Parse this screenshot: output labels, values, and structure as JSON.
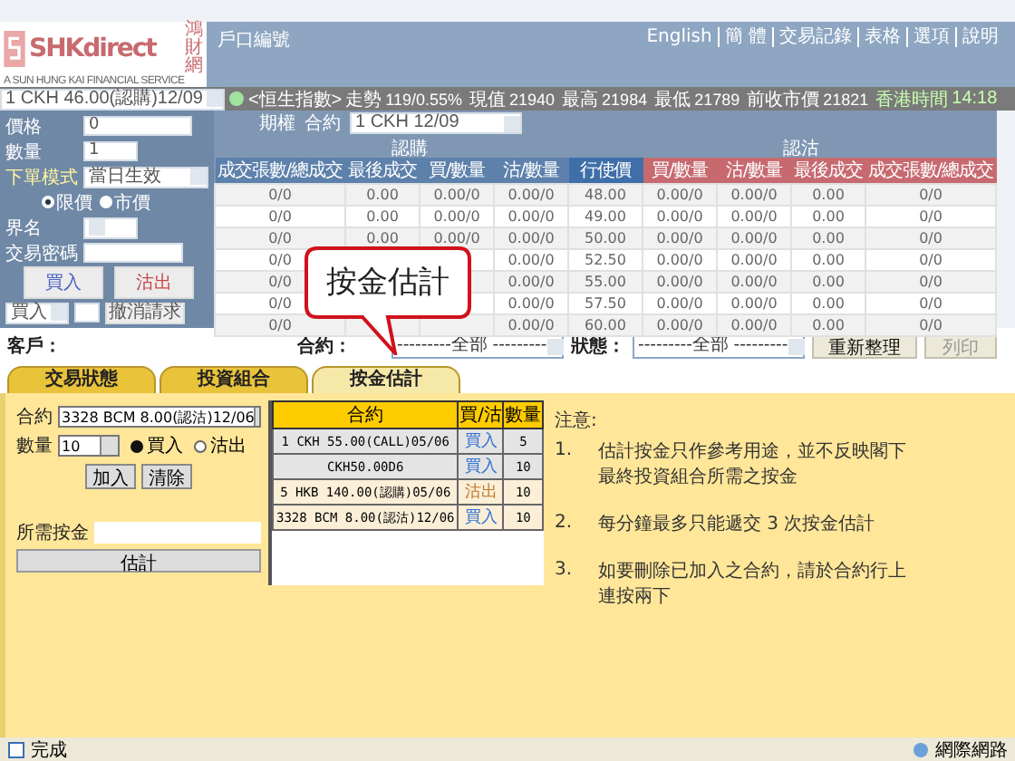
{
  "header": {
    "logo": "SHKdirect",
    "logo_tagline": "A SUN HUNG KAI FINANCIAL SERVICE",
    "logo_side": "鴻財網",
    "account_label": "戶口編號",
    "links": [
      "English",
      "簡 體",
      "交易記錄",
      "表格",
      "選項",
      "說明"
    ]
  },
  "ticker": {
    "contract": "1 CKH 46.00(認購)12/09",
    "index": "<恒生指數>",
    "items": [
      {
        "label": "走勢",
        "value": "119/0.55%"
      },
      {
        "label": "現值",
        "value": "21940"
      },
      {
        "label": "最高",
        "value": "21984"
      },
      {
        "label": "最低",
        "value": "21789"
      },
      {
        "label": "前收市價",
        "value": "21821"
      }
    ],
    "time_label": "香港時間",
    "time": "14:18"
  },
  "order_form": {
    "price_label": "價格",
    "price": "0",
    "qty_label": "數量",
    "qty": "1",
    "mode_label": "下單模式",
    "mode": "當日生效",
    "order_types": [
      {
        "label": "限價",
        "selected": true
      },
      {
        "label": "市價",
        "selected": false
      }
    ],
    "name_label": "界名",
    "password_label": "交易密碼",
    "buy_button": "買入",
    "sell_button": "沽出",
    "side_select": "買入",
    "cancel_button": "撤消請求"
  },
  "options": {
    "type_label": "期權",
    "contract_label": "合約",
    "contract": "1 CKH 12/09",
    "call_label": "認購",
    "put_label": "認沽",
    "columns": [
      "成交張數/總成交",
      "最後成交",
      "買/數量",
      "沽/數量",
      "行使價",
      "買/數量",
      "沽/數量",
      "最後成交",
      "成交張數/總成交"
    ],
    "rows": [
      [
        "0/0",
        "0.00",
        "0.00/0",
        "0.00/0",
        "48.00",
        "0.00/0",
        "0.00/0",
        "0.00",
        "0/0"
      ],
      [
        "0/0",
        "0.00",
        "0.00/0",
        "0.00/0",
        "49.00",
        "0.00/0",
        "0.00/0",
        "0.00",
        "0/0"
      ],
      [
        "0/0",
        "0.00",
        "0.00/0",
        "0.00/0",
        "50.00",
        "0.00/0",
        "0.00/0",
        "0.00",
        "0/0"
      ],
      [
        "0/0",
        null,
        null,
        "0.00/0",
        "52.50",
        "0.00/0",
        "0.00/0",
        "0.00",
        "0/0"
      ],
      [
        "0/0",
        null,
        null,
        "0.00/0",
        "55.00",
        "0.00/0",
        "0.00/0",
        "0.00",
        "0/0"
      ],
      [
        "0/0",
        null,
        null,
        "0.00/0",
        "57.50",
        "0.00/0",
        "0.00/0",
        "0.00",
        "0/0"
      ],
      [
        "0/0",
        null,
        null,
        "0.00/0",
        "60.00",
        "0.00/0",
        "0.00/0",
        "0.00",
        "0/0"
      ]
    ]
  },
  "callout": "按金估計",
  "filter": {
    "client_label": "客戶：",
    "contract_label": "合約：",
    "contract": "---------全部 ---------",
    "status_label": "狀態：",
    "status": "---------全部 ---------",
    "buttons": [
      {
        "label": "重新整理",
        "disabled": false
      },
      {
        "label": "列印",
        "disabled": true
      }
    ]
  },
  "tabs": [
    {
      "label": "交易狀態",
      "selected": false
    },
    {
      "label": "投資組合",
      "selected": false
    },
    {
      "label": "按金估計",
      "selected": true
    }
  ],
  "margin": {
    "contract_label": "合約",
    "contract": "3328 BCM 8.00(認沽)12/06",
    "qty_label": "數量",
    "qty": "10",
    "sides": [
      {
        "label": "買入",
        "selected": true
      },
      {
        "label": "沽出",
        "selected": false
      }
    ],
    "add_button": "加入",
    "clear_button": "清除",
    "required_label": "所需按金",
    "estimate_button": "估計",
    "columns": [
      "合約",
      "買/沽",
      "數量"
    ],
    "rows": [
      {
        "contract": "1 CKH 55.00(CALL)05/06",
        "side": "買入",
        "color": "#2f6fd0",
        "qty": "5"
      },
      {
        "contract": "CKH50.00D6",
        "side": "買入",
        "color": "#2f6fd0",
        "qty": "10"
      },
      {
        "contract": "5 HKB 140.00(認購)05/06",
        "side": "沽出",
        "color": "#c0782a",
        "qty": "10"
      },
      {
        "contract": "3328 BCM 8.00(認沽)12/06",
        "side": "買入",
        "color": "#2f6fd0",
        "qty": "10"
      }
    ],
    "notes_title": "注意:",
    "notes": [
      {
        "num": "1.",
        "lines": [
          "估計按金只作參考用途，並不反映閣下",
          "最終投資組合所需之按金"
        ]
      },
      {
        "num": "2.",
        "lines": [
          "每分鐘最多只能遞交 3 次按金估計"
        ]
      },
      {
        "num": "3.",
        "lines": [
          "如要刪除已加入之合約，請於合約行上",
          "連按兩下"
        ]
      }
    ]
  },
  "status_bar": {
    "text": "完成",
    "zone": "網際網路"
  }
}
